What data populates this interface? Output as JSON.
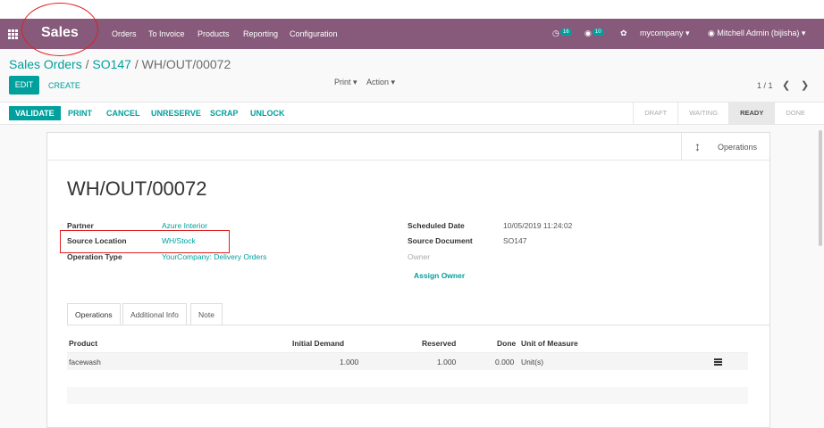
{
  "nav": {
    "brand": "Sales",
    "menu": [
      "Orders",
      "To Invoice",
      "Products",
      "Reporting",
      "Configuration"
    ],
    "activity_count": "16",
    "message_count": "10",
    "company": "mycompany",
    "user": "Mitchell Admin (bijisha)"
  },
  "breadcrumb": {
    "root": "Sales Orders",
    "sep1": " / ",
    "order": "SO147",
    "sep2": " / ",
    "current": "WH/OUT/00072"
  },
  "control": {
    "edit": "EDIT",
    "create": "CREATE",
    "print": "Print",
    "action": "Action",
    "pager": "1 / 1"
  },
  "statusbar": {
    "buttons": [
      "VALIDATE",
      "PRINT",
      "CANCEL",
      "UNRESERVE",
      "SCRAP",
      "UNLOCK"
    ],
    "stages": [
      "DRAFT",
      "WAITING",
      "READY",
      "DONE"
    ],
    "active_stage": "READY"
  },
  "smart_button": {
    "label": "Operations",
    "icon": "arrows-v-icon"
  },
  "record": {
    "name": "WH/OUT/00072",
    "partner_label": "Partner",
    "partner": "Azure Interior",
    "source_label": "Source Location",
    "source": "WH/Stock",
    "optype_label": "Operation Type",
    "optype": "YourCompany: Delivery Orders",
    "sched_label": "Scheduled Date",
    "sched": "10/05/2019 11:24:02",
    "srcdoc_label": "Source Document",
    "srcdoc": "SO147",
    "owner_placeholder": "Owner",
    "assign_owner": "Assign Owner"
  },
  "tabs": [
    "Operations",
    "Additional Info",
    "Note"
  ],
  "table": {
    "headers": [
      "Product",
      "Initial Demand",
      "Reserved",
      "Done",
      "Unit of Measure"
    ],
    "rows": [
      {
        "product": "facewash",
        "demand": "1.000",
        "reserved": "1.000",
        "done": "0.000",
        "uom": "Unit(s)"
      }
    ]
  },
  "colors": {
    "brand": "#875a7b",
    "accent": "#00a09d",
    "annotation": "#e02020"
  }
}
